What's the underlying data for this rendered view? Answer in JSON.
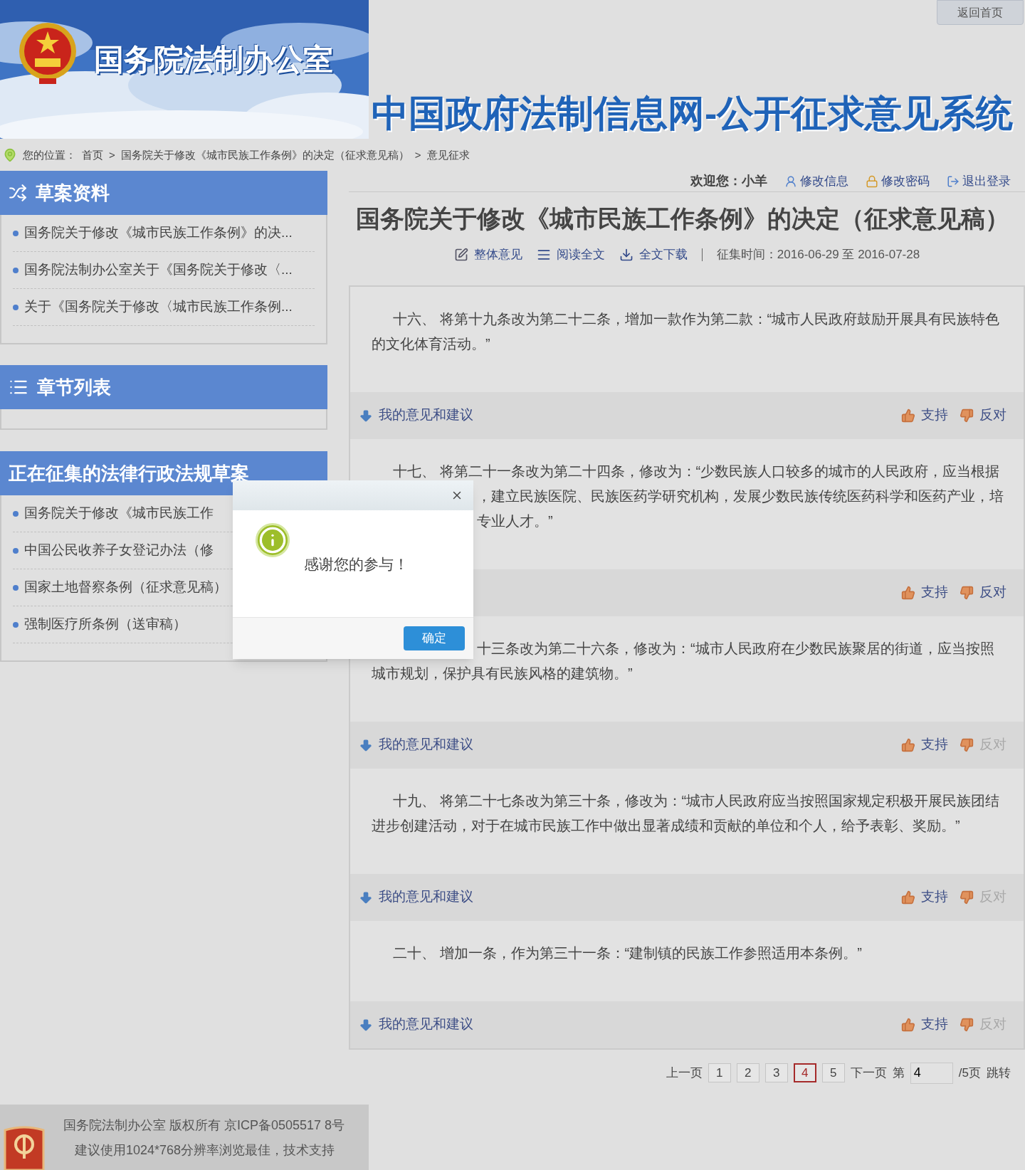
{
  "header": {
    "org_name": "国务院法制办公室",
    "site_title": "中国政府法制信息网-公开征求意见系统",
    "home_link": "返回首页"
  },
  "breadcrumb": {
    "label": "您的位置：",
    "items": [
      "首页",
      "国务院关于修改《城市民族工作条例》的决定（征求意见稿）",
      "意见征求"
    ],
    "separator": ">"
  },
  "sidebar": {
    "panels": [
      {
        "kind": "materials",
        "title": "草案资料",
        "items": [
          "国务院关于修改《城市民族工作条例》的决...",
          "国务院法制办公室关于《国务院关于修改〈...",
          "关于《国务院关于修改〈城市民族工作条例..."
        ]
      },
      {
        "kind": "chapters",
        "title": "章节列表"
      },
      {
        "kind": "plain",
        "title": "正在征集的法律行政法规草案",
        "items": [
          "国务院关于修改《城市民族工作",
          "中国公民收养子女登记办法（修",
          "国家土地督察条例（征求意见稿）",
          "强制医疗所条例（送审稿）"
        ]
      }
    ]
  },
  "user_bar": {
    "welcome": "欢迎您：小羊",
    "links": [
      {
        "kind": "user",
        "label": "修改信息"
      },
      {
        "kind": "lock",
        "label": "修改密码"
      },
      {
        "kind": "logout",
        "label": "退出登录"
      }
    ]
  },
  "document": {
    "title": "国务院关于修改《城市民族工作条例》的决定（征求意见稿）",
    "actions": [
      {
        "kind": "edit",
        "label": "整体意见"
      },
      {
        "kind": "read",
        "label": "阅读全文"
      },
      {
        "kind": "download",
        "label": "全文下载"
      }
    ],
    "period": "征集时间：2016-06-29 至 2016-07-28"
  },
  "clauses": [
    {
      "lines": [
        {
          "kind": "indent",
          "text": "十六、 将第十九条改为第二十二条，增加一款作为第二款：“城市人民政府鼓励开展具有民族特色"
        },
        {
          "kind": "plain",
          "text": "的文化体育活动。”"
        }
      ],
      "comment_label": "我的意见和建议",
      "support": "支持",
      "oppose": {
        "label": "反对",
        "disabled": false
      }
    },
    {
      "lines": [
        {
          "kind": "indent",
          "text": "十七、 将第二十一条改为第二十四条，修改为：“少数民族人口较多的城市的人民政府，应当根据"
        },
        {
          "kind": "covered",
          "text": "，建立民族医院、民族医药学研究机构，发展少数民族传统医药科学和医药产业，培"
        },
        {
          "kind": "covered",
          "text": "专业人才。”"
        }
      ],
      "support": "支持",
      "oppose": {
        "label": "反对",
        "disabled": false
      }
    },
    {
      "lines": [
        {
          "kind": "covered",
          "text": "十三条改为第二十六条，修改为：“城市人民政府在少数民族聚居的街道，应当按照"
        },
        {
          "kind": "plain",
          "text": "城市规划，保护具有民族风格的建筑物。”"
        }
      ],
      "comment_label": "我的意见和建议",
      "support": "支持",
      "oppose": {
        "label": "反对",
        "disabled": true
      }
    },
    {
      "lines": [
        {
          "kind": "indent",
          "text": "十九、 将第二十七条改为第三十条，修改为：“城市人民政府应当按照国家规定积极开展民族团结"
        },
        {
          "kind": "plain",
          "text": "进步创建活动，对于在城市民族工作中做出显著成绩和贡献的单位和个人，给予表彰、奖励。”"
        }
      ],
      "comment_label": "我的意见和建议",
      "support": "支持",
      "oppose": {
        "label": "反对",
        "disabled": true
      }
    },
    {
      "lines": [
        {
          "kind": "indent",
          "text": "二十、 增加一条，作为第三十一条：“建制镇的民族工作参照适用本条例。”"
        }
      ],
      "comment_label": "我的意见和建议",
      "support": "支持",
      "oppose": {
        "label": "反对",
        "disabled": true
      }
    }
  ],
  "pagination": {
    "prev": "上一页",
    "pages": [
      {
        "label": "1",
        "selected": false
      },
      {
        "label": "2",
        "selected": false
      },
      {
        "label": "3",
        "selected": false
      },
      {
        "label": "4",
        "selected": true
      },
      {
        "label": "5",
        "selected": false
      }
    ],
    "next": "下一页",
    "goto_prefix": "第",
    "goto_value": "4",
    "total": "/5页",
    "jump": "跳转"
  },
  "dialog": {
    "message": "感谢您的参与！",
    "confirm": "确定"
  },
  "footer": {
    "copyright": "国务院法制办公室 版权所有 京ICP备0505517 8号",
    "hint": "建议使用1024*768分辨率浏览最佳，技术支持"
  }
}
